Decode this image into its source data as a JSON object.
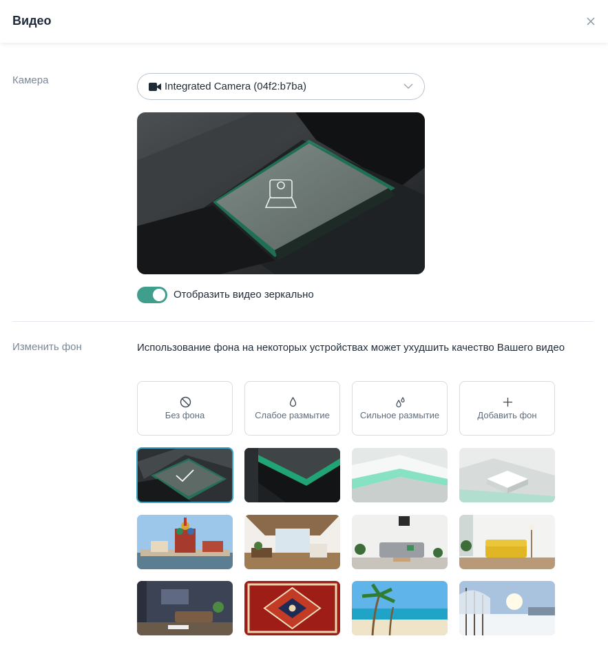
{
  "header": {
    "title": "Видео",
    "close_icon": "close-icon"
  },
  "camera": {
    "section_label": "Камера",
    "select_icon": "video-camera-icon",
    "selected_value": "Integrated Camera (04f2:b7ba)",
    "mirror_toggle": {
      "on": true,
      "label": "Отобразить видео зеркально"
    }
  },
  "background": {
    "section_label": "Изменить фон",
    "notice": "Использование фона на некоторых устройствах может ухудшить качество Вашего видео",
    "options": [
      {
        "label": "Без фона",
        "icon": "no-background-icon"
      },
      {
        "label": "Слабое размытие",
        "icon": "drop-icon"
      },
      {
        "label": "Сильное размытие",
        "icon": "drops-icon"
      },
      {
        "label": "Добавить фон",
        "icon": "plus-icon"
      }
    ],
    "thumbnails": [
      "dark-green-1",
      "dark-green-2",
      "light-green-1",
      "light-green-2",
      "moscow",
      "loft-room",
      "grey-sofa-room",
      "yellow-sofa-room",
      "dark-living-room",
      "carpet",
      "palm-beach",
      "winter-forest"
    ],
    "selected_index": 0
  },
  "colors": {
    "accent": "#3f9f8c",
    "selection": "#3aa5c8"
  }
}
